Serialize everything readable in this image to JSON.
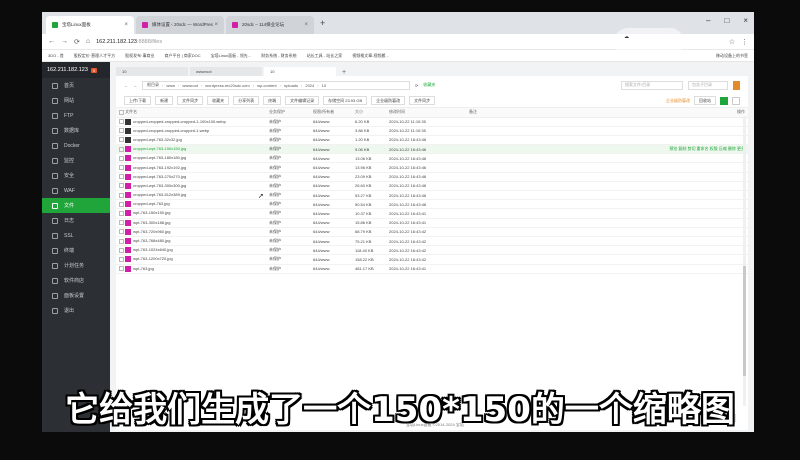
{
  "browser": {
    "tabs": [
      {
        "label": "宝塔Linux面板",
        "color": "#20a53a",
        "active": true
      },
      {
        "label": "媒体设置 ‹ 20sdc — WordPres",
        "color": "#d21fa8",
        "active": false
      },
      {
        "label": "20sdc – 114择业论坛",
        "color": "#d21fa8",
        "active": false
      }
    ],
    "new_tab": "+",
    "url_host": "162.211.182.123",
    "url_rest": ":8888/files",
    "bookmarks": [
      "3DO - 首",
      "股权定价·营理人才平方",
      "股权发布·事商业",
      "商户平台 | 商家DOC",
      "宝塔Linux面板 - 领先...",
      "财务系统 - 财务系统",
      "站长工具 - 站长之家",
      "视频格文章-视频搬..."
    ],
    "bookmarks_right": "移动设备上的书签"
  },
  "sidebar": {
    "ip": "162.211.182.123",
    "badge": "0",
    "items": [
      {
        "label": "首页",
        "active": false
      },
      {
        "label": "网站",
        "active": false
      },
      {
        "label": "FTP",
        "active": false
      },
      {
        "label": "数据库",
        "active": false
      },
      {
        "label": "Docker",
        "active": false
      },
      {
        "label": "监控",
        "active": false
      },
      {
        "label": "安全",
        "active": false
      },
      {
        "label": "WAF",
        "active": false
      },
      {
        "label": "文件",
        "active": true
      },
      {
        "label": "日志",
        "active": false
      },
      {
        "label": "SSL",
        "active": false
      },
      {
        "label": "终端",
        "active": false
      },
      {
        "label": "计划任务",
        "active": false
      },
      {
        "label": "软件商店",
        "active": false
      },
      {
        "label": "面板设置",
        "active": false
      },
      {
        "label": "退出",
        "active": false
      }
    ]
  },
  "file_tabs": [
    "10",
    "wwwroot",
    "10"
  ],
  "path": {
    "crumbs": [
      "根目录",
      "www",
      "wwwroot",
      "wordpress.rec20sdc.com",
      "wp-content",
      "uploads",
      "2024",
      "10"
    ],
    "favorite": "收藏夹",
    "search_placeholder": "搜索文件/目录",
    "sub_placeholder": "包含子目录"
  },
  "toolbar": {
    "buttons": [
      "上传/下载",
      "新建",
      "文件同步",
      "收藏夹",
      "分享列表",
      "终端",
      "文件编辑记录",
      "存储空间 23.93 GB",
      "企业级防篡改",
      "文件同步"
    ],
    "right_text": "企业级防篡改",
    "trash": "回收站"
  },
  "table": {
    "columns": [
      "文件名",
      "业务保护",
      "权限/所有者",
      "大小",
      "修改时间",
      "备注",
      "操作"
    ],
    "rows": [
      {
        "name": "cropped-cropped-cropped-cropped-1-100x100.webp",
        "prot": "未保护",
        "perm": "644/www",
        "size": "6.20 KB",
        "time": "2024-10-22 11:10:35",
        "dark": true,
        "hl": false
      },
      {
        "name": "cropped-cropped-cropped-cropped-1.webp",
        "prot": "未保护",
        "perm": "644/www",
        "size": "3.88 KB",
        "time": "2024-10-22 11:10:35",
        "dark": true,
        "hl": false
      },
      {
        "name": "cropped-wpt-763-32x32.jpg",
        "prot": "未保护",
        "perm": "644/www",
        "size": "1.20 KB",
        "time": "2024-10-22 16:43:46",
        "dark": true,
        "hl": false
      },
      {
        "name": "cropped-wpt-763-150x150.jpg",
        "prot": "未保护",
        "perm": "644/www",
        "size": "9.06 KB",
        "time": "2024-10-22 16:43:46",
        "dark": false,
        "hl": true
      },
      {
        "name": "cropped-wpt-763-180x180.jpg",
        "prot": "未保护",
        "perm": "644/www",
        "size": "13.06 KB",
        "time": "2024-10-22 16:43:46",
        "dark": false,
        "hl": false
      },
      {
        "name": "cropped-wpt-763-192x192.jpg",
        "prot": "未保护",
        "perm": "644/www",
        "size": "13.96 KB",
        "time": "2024-10-22 16:43:46",
        "dark": false,
        "hl": false
      },
      {
        "name": "cropped-wpt-763-270x270.jpg",
        "prot": "未保护",
        "perm": "644/www",
        "size": "23.09 KB",
        "time": "2024-10-22 16:43:46",
        "dark": false,
        "hl": false
      },
      {
        "name": "cropped-wpt-763-300x300.jpg",
        "prot": "未保护",
        "perm": "644/www",
        "size": "26.60 KB",
        "time": "2024-10-22 16:43:46",
        "dark": false,
        "hl": false
      },
      {
        "name": "cropped-wpt-763-512x389.jpg",
        "prot": "未保护",
        "perm": "644/www",
        "size": "53.27 KB",
        "time": "2024-10-22 16:43:46",
        "dark": false,
        "hl": false
      },
      {
        "name": "cropped-wpt-763.jpg",
        "prot": "未保护",
        "perm": "644/www",
        "size": "50.54 KB",
        "time": "2024-10-22 16:43:46",
        "dark": false,
        "hl": false
      },
      {
        "name": "wpt-763-150x150.jpg",
        "prot": "未保护",
        "perm": "644/www",
        "size": "10.37 KB",
        "time": "2024-10-22 16:43:41",
        "dark": false,
        "hl": false
      },
      {
        "name": "wpt-763-300x188.jpg",
        "prot": "未保护",
        "perm": "644/www",
        "size": "15.86 KB",
        "time": "2024-10-22 16:43:41",
        "dark": false,
        "hl": false
      },
      {
        "name": "wpt-763-720x960.jpg",
        "prot": "未保护",
        "perm": "644/www",
        "size": "68.79 KB",
        "time": "2024-10-22 16:43:42",
        "dark": false,
        "hl": false
      },
      {
        "name": "wpt-763-768x480.jpg",
        "prot": "未保护",
        "perm": "644/www",
        "size": "75.21 KB",
        "time": "2024-10-22 16:43:42",
        "dark": false,
        "hl": false
      },
      {
        "name": "wpt-763-1024x640.jpg",
        "prot": "未保护",
        "perm": "644/www",
        "size": "118.40 KB",
        "time": "2024-10-22 16:43:42",
        "dark": false,
        "hl": false
      },
      {
        "name": "wpt-763-1200x720.jpg",
        "prot": "未保护",
        "perm": "644/www",
        "size": "158.22 KB",
        "time": "2024-10-22 16:43:42",
        "dark": false,
        "hl": false
      },
      {
        "name": "wpt-763.jpg",
        "prot": "未保护",
        "perm": "644/www",
        "size": "481.17 KB",
        "time": "2024-10-22 16:43:41",
        "dark": false,
        "hl": false
      }
    ],
    "row_ops": "预览  复制  剪切  重命名  权限  压缩  删除  更多",
    "pinned_ops": "预览 复制 剪切 重命名 权限 压缩 删除 更多"
  },
  "footer": "宝塔Linux面板 ©2014-2024 宝塔",
  "subtitle": "它给我们生成了一个150*150的一个缩略图",
  "colors": {
    "accent": "#20a53a",
    "file_icon": "#d21fa8",
    "sidebar": "#2c3034"
  }
}
